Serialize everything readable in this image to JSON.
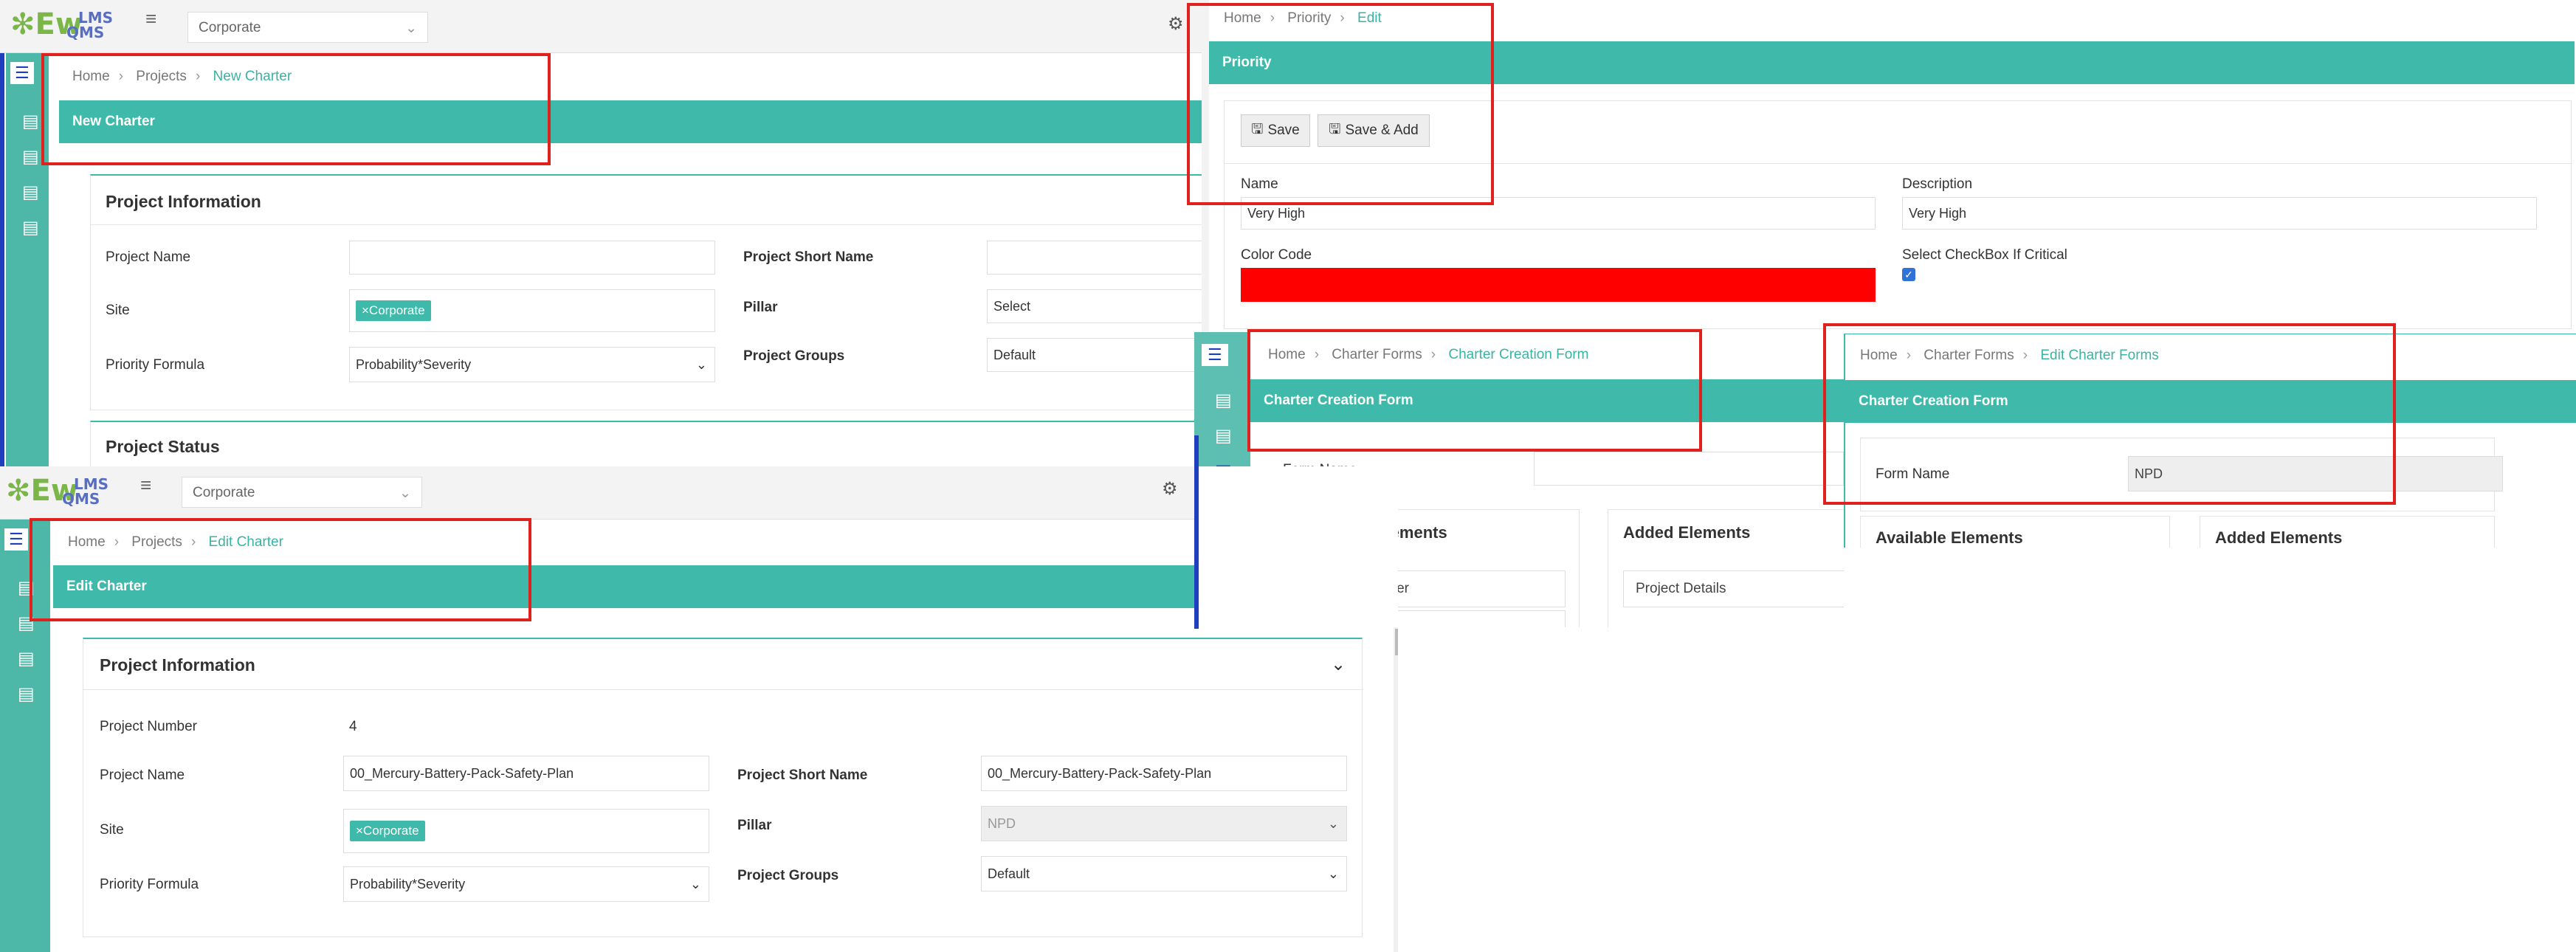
{
  "logo": {
    "text": "Ew",
    "superscript": "LMS",
    "subscript": "QMS"
  },
  "new_charter": {
    "site_select": "Corporate",
    "breadcrumb": [
      "Home",
      "Projects",
      "New Charter"
    ],
    "band_title": "New Charter",
    "project_information": {
      "title": "Project Information",
      "project_name_label": "Project Name",
      "project_name_value": "",
      "project_short_name_label": "Project Short Name",
      "site_label": "Site",
      "site_tag": "×Corporate",
      "pillar_label": "Pillar",
      "pillar_value": "Select",
      "priority_formula_label": "Priority Formula",
      "priority_formula_value": "Probability*Severity",
      "project_groups_label": "Project Groups",
      "project_groups_value": "Default"
    },
    "project_status_title": "Project Status"
  },
  "priority_edit": {
    "breadcrumb": [
      "Home",
      "Priority",
      "Edit"
    ],
    "band_title": "Priority",
    "save_label": "Save",
    "save_add_label": "Save & Add",
    "name_label": "Name",
    "name_value": "Very High",
    "description_label": "Description",
    "description_value": "Very High",
    "color_code_label": "Color Code",
    "color_code_value": "#ff0000",
    "critical_label": "Select CheckBox If Critical",
    "critical_checked": true
  },
  "charter_creation_form": {
    "breadcrumb": [
      "Home",
      "Charter Forms",
      "Charter Creation Form"
    ],
    "band_title": "Charter Creation Form",
    "form_name_label": "Form Name",
    "form_name_value": "",
    "available_elements_title": "Available Elements",
    "added_elements_title": "Added Elements",
    "available_items": [
      "Section Header"
    ],
    "added_items": [
      "Project Details"
    ]
  },
  "edit_charter_forms": {
    "breadcrumb": [
      "Home",
      "Charter Forms",
      "Edit Charter Forms"
    ],
    "band_title": "Charter Creation Form",
    "form_name_label": "Form Name",
    "form_name_value": "NPD",
    "available_elements_title": "Available Elements",
    "added_elements_title": "Added Elements"
  },
  "edit_charter": {
    "site_select": "Corporate",
    "breadcrumb": [
      "Home",
      "Projects",
      "Edit Charter"
    ],
    "band_title": "Edit Charter",
    "project_information": {
      "title": "Project Information",
      "project_number_label": "Project Number",
      "project_number_value": "4",
      "project_name_label": "Project Name",
      "project_name_value": "00_Mercury-Battery-Pack-Safety-Plan",
      "project_short_name_label": "Project Short Name",
      "project_short_name_value": "00_Mercury-Battery-Pack-Safety-Plan",
      "site_label": "Site",
      "site_tag": "×Corporate",
      "pillar_label": "Pillar",
      "pillar_value": "NPD",
      "priority_formula_label": "Priority Formula",
      "priority_formula_value": "Probability*Severity",
      "project_groups_label": "Project Groups",
      "project_groups_value": "Default"
    }
  },
  "colors": {
    "teal": "#3fb9a9",
    "highlight": "#e0221e",
    "accent_blue": "#1f3fbf"
  }
}
